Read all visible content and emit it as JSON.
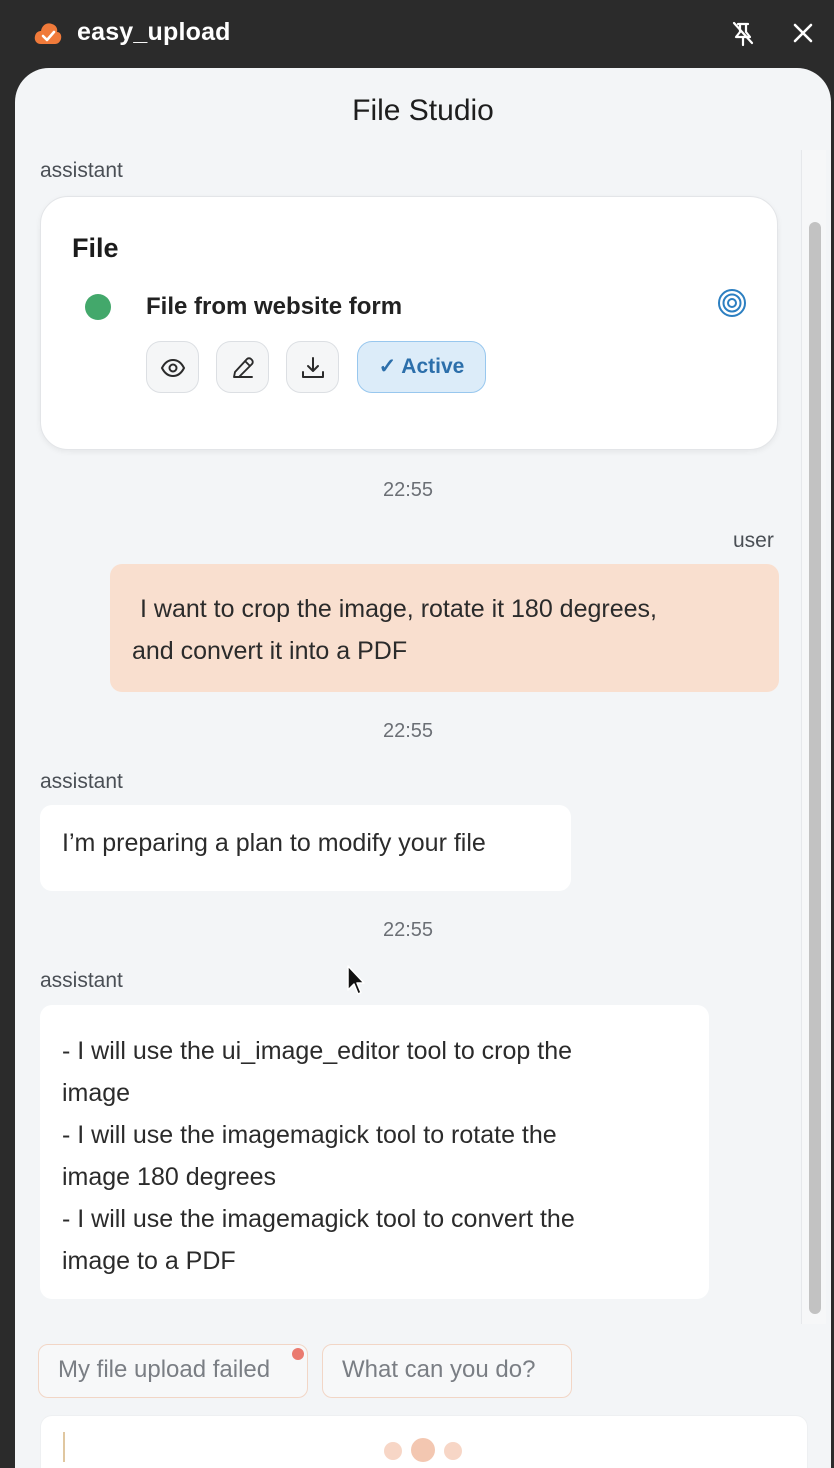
{
  "window": {
    "title": "easy_upload",
    "icons": {
      "logo": "cloud-check-icon",
      "pin": "unpin-icon",
      "close": "close-icon"
    }
  },
  "panel": {
    "title": "File Studio"
  },
  "messages": {
    "m1": {
      "role": "assistant"
    },
    "file_card": {
      "title": "File",
      "status_color": "#43a86b",
      "file_name": "File from website form",
      "badge": "✓ Active",
      "actions": [
        "eye-icon",
        "pencil-icon",
        "download-icon"
      ]
    },
    "t1": "22:55",
    "m2": {
      "role": "user",
      "line1": "I want to crop the image, rotate it 180 degrees,",
      "line2": "and convert it into a PDF"
    },
    "t2": "22:55",
    "m3": {
      "role": "assistant",
      "text": "I’m preparing a plan to modify your file"
    },
    "t3": "22:55",
    "m4": {
      "role": "assistant",
      "lines": [
        "- I will use the ui_image_editor tool to crop the",
        "image",
        "- I will use the imagemagick tool to rotate the",
        "image 180 degrees",
        "- I will use the imagemagick tool to convert the",
        "image to a PDF"
      ]
    }
  },
  "suggestions": [
    "My file upload failed",
    "What can you do?"
  ],
  "colors": {
    "user_bubble": "#f9dfcf",
    "accent": "#f07a3a",
    "badge_bg": "#dcecf9",
    "badge_text": "#2c6fab"
  }
}
